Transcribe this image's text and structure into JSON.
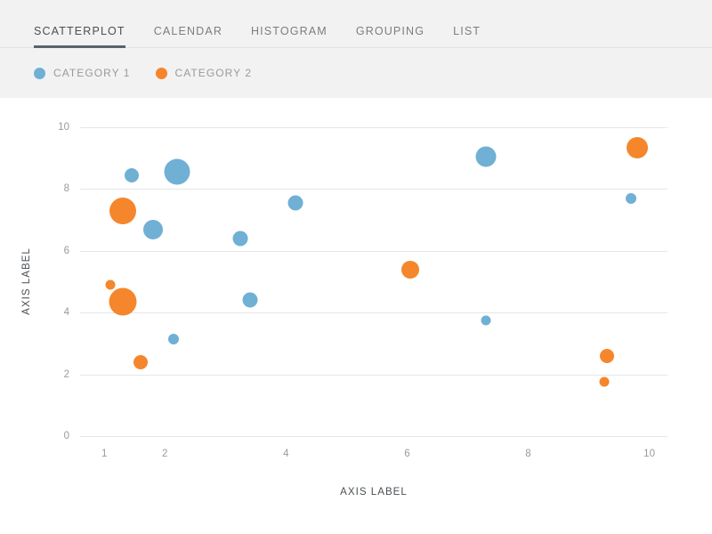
{
  "tabs": [
    {
      "label": "SCATTERPLOT",
      "active": true
    },
    {
      "label": "CALENDAR",
      "active": false
    },
    {
      "label": "HISTOGRAM",
      "active": false
    },
    {
      "label": "GROUPING",
      "active": false
    },
    {
      "label": "LIST",
      "active": false
    }
  ],
  "colors": {
    "category1": "#6fb0d4",
    "category2": "#f5862c",
    "header_bg": "#f2f2f2",
    "plot_bg": "#ffffff",
    "gridline": "#e6e6e6",
    "tab_active": "#4a4f54",
    "tab_inactive": "#7d7d7d",
    "tab_underline": "#59636b",
    "tick_text": "#9a9a9a",
    "axis_label_text": "#4a4f54"
  },
  "legend": [
    {
      "label": "CATEGORY 1",
      "color": "#6fb0d4",
      "series": "Category 1"
    },
    {
      "label": "CATEGORY 2",
      "color": "#f5862c",
      "series": "Category 2"
    }
  ],
  "chart_data": {
    "type": "scatter",
    "title": "",
    "xlabel": "AXIS LABEL",
    "ylabel": "AXIS LABEL",
    "xlim": [
      0.6,
      10.3
    ],
    "ylim": [
      0,
      10
    ],
    "xticks": [
      1,
      2,
      4,
      6,
      8,
      10
    ],
    "yticks": [
      0,
      2,
      4,
      6,
      8,
      10
    ],
    "grid": "horizontal",
    "legend_position": "top-left",
    "size_encoding": "bubble radius encodes a third value",
    "series": [
      {
        "name": "Category 1",
        "color": "#6fb0d4",
        "points": [
          {
            "x": 1.45,
            "y": 8.45,
            "size": 16
          },
          {
            "x": 2.2,
            "y": 8.55,
            "size": 29
          },
          {
            "x": 1.8,
            "y": 6.7,
            "size": 22
          },
          {
            "x": 3.25,
            "y": 6.4,
            "size": 17
          },
          {
            "x": 4.15,
            "y": 7.55,
            "size": 17
          },
          {
            "x": 3.4,
            "y": 4.4,
            "size": 17
          },
          {
            "x": 2.15,
            "y": 3.15,
            "size": 12
          },
          {
            "x": 7.3,
            "y": 9.05,
            "size": 23
          },
          {
            "x": 9.7,
            "y": 7.7,
            "size": 12
          },
          {
            "x": 7.3,
            "y": 3.75,
            "size": 11
          }
        ]
      },
      {
        "name": "Category 2",
        "color": "#f5862c",
        "points": [
          {
            "x": 1.3,
            "y": 7.3,
            "size": 30
          },
          {
            "x": 1.1,
            "y": 4.9,
            "size": 11
          },
          {
            "x": 1.3,
            "y": 4.35,
            "size": 31
          },
          {
            "x": 1.6,
            "y": 2.4,
            "size": 16
          },
          {
            "x": 6.05,
            "y": 5.4,
            "size": 20
          },
          {
            "x": 9.8,
            "y": 9.35,
            "size": 24
          },
          {
            "x": 9.3,
            "y": 2.6,
            "size": 16
          },
          {
            "x": 9.25,
            "y": 1.75,
            "size": 11
          }
        ]
      }
    ]
  }
}
